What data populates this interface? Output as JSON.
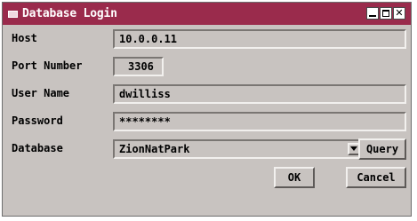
{
  "window": {
    "title": "Database Login",
    "controls": [
      "minimize-icon",
      "maximize-icon",
      "close-icon"
    ],
    "close_glyph": "✕",
    "titlebar_color": "#9a2b4c",
    "background_color": "#c8c3c0"
  },
  "form": {
    "host_label": "Host",
    "host_value": "10.0.0.11",
    "port_label": "Port Number",
    "port_value": "3306",
    "user_label": "User Name",
    "user_value": "dwilliss",
    "password_label": "Password",
    "password_value": "********",
    "database_label": "Database",
    "database_value": "ZionNatPark"
  },
  "buttons": {
    "query": "Query",
    "ok": "OK",
    "cancel": "Cancel"
  }
}
